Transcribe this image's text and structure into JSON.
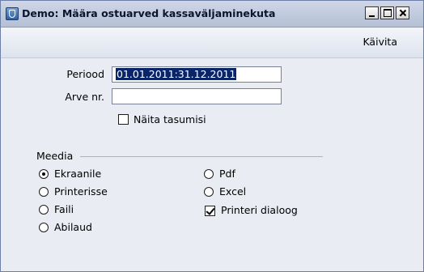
{
  "window": {
    "title": "Demo: Määra ostuarved kassaväljaminekuta",
    "icon": "app-icon"
  },
  "toolbar": {
    "run_label": "Käivita"
  },
  "form": {
    "period_label": "Periood",
    "period_value": "01.01.2011:31.12.2011",
    "invoice_label": "Arve nr.",
    "invoice_value": "",
    "show_settlements_label": "Näita tasumisi",
    "show_settlements_checked": false
  },
  "media": {
    "title": "Meedia",
    "options": [
      {
        "label": "Ekraanile",
        "selected": true
      },
      {
        "label": "Printerisse",
        "selected": false
      },
      {
        "label": "Faili",
        "selected": false
      },
      {
        "label": "Abilaud",
        "selected": false
      },
      {
        "label": "Pdf",
        "selected": false
      },
      {
        "label": "Excel",
        "selected": false
      }
    ],
    "printer_dialog_label": "Printeri dialoog",
    "printer_dialog_checked": true
  }
}
